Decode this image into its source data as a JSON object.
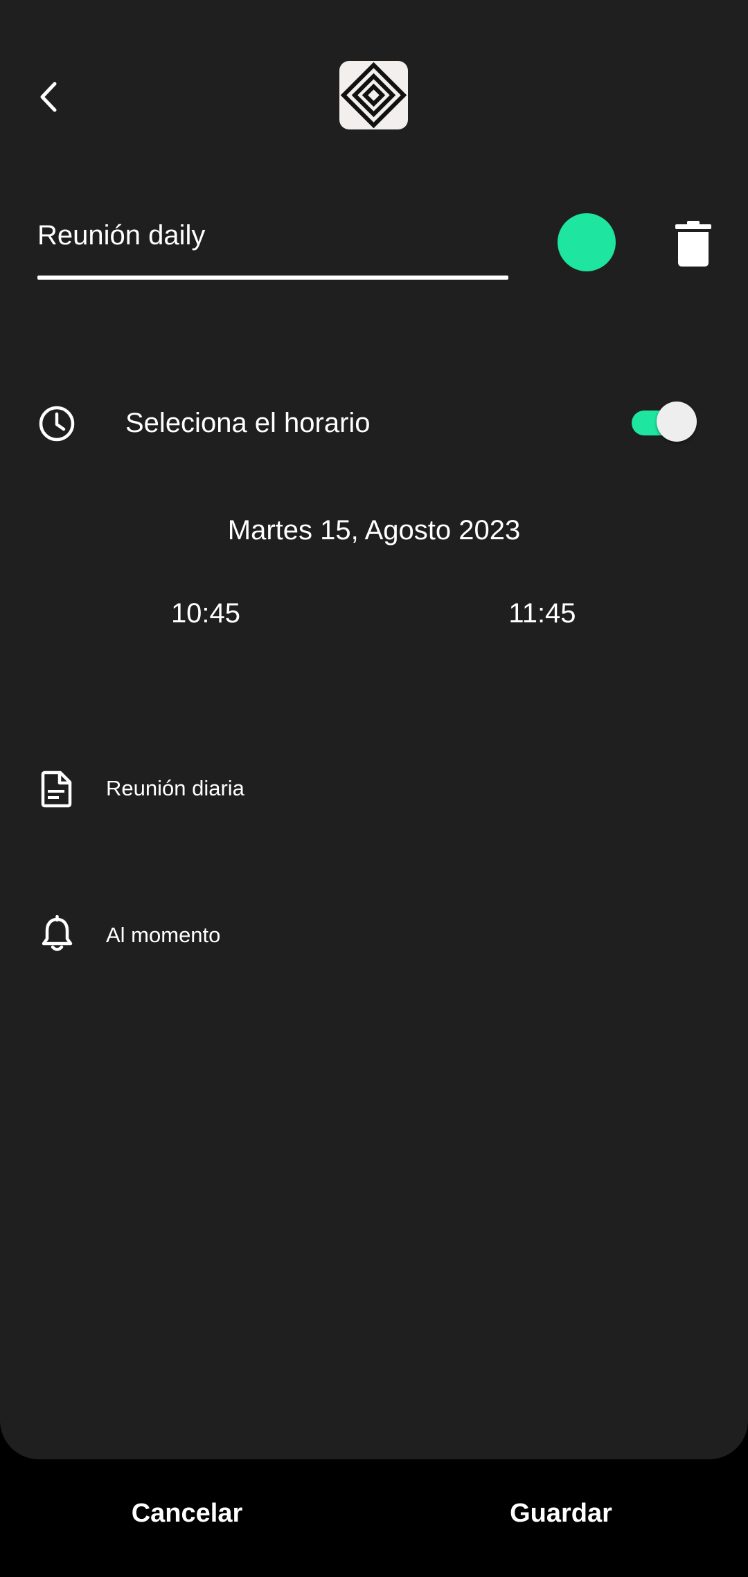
{
  "header": {
    "back_icon": "chevron-left-icon",
    "logo_icon": "concentric-diamonds-logo"
  },
  "event": {
    "title_value": "Reunión daily",
    "color": "#1ee59f",
    "delete_icon": "trash-icon"
  },
  "schedule": {
    "icon": "clock-icon",
    "label": "Seleciona el horario",
    "toggle_on": true,
    "toggle_color": "#1ee59f",
    "date": "Martes 15, Agosto 2023",
    "start_time": "10:45",
    "end_time": "11:45"
  },
  "description": {
    "icon": "document-icon",
    "text": "Reunión diaria"
  },
  "notification": {
    "icon": "bell-icon",
    "text": "Al momento"
  },
  "actions": {
    "cancel_label": "Cancelar",
    "save_label": "Guardar"
  }
}
